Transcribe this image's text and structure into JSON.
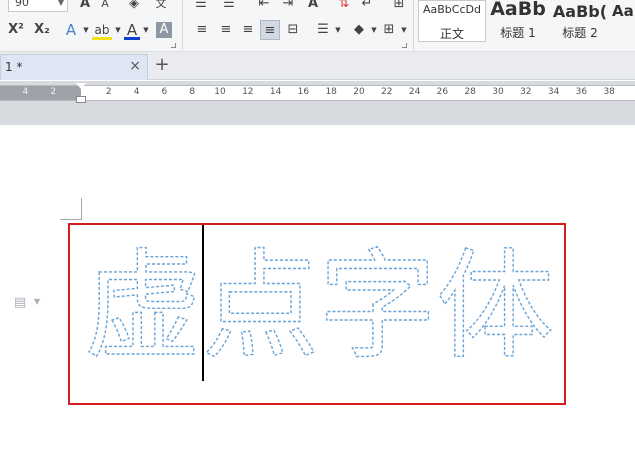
{
  "ribbon": {
    "font_size": "90",
    "grow_font": "A",
    "shrink_font": "A",
    "superscript": "X²",
    "subscript": "X₂",
    "text_effect": "A",
    "highlight": "ab",
    "font_color": "A",
    "char_shading": "A",
    "phonetic": "文",
    "styles": [
      {
        "preview": "AaBbCcDd",
        "name": "正文"
      },
      {
        "preview": "AaBb",
        "name": "标题 1"
      },
      {
        "preview": "AaBb(",
        "name": "标题 2"
      },
      {
        "preview": "Aa",
        "name": ""
      }
    ],
    "colors": {
      "font_color_bar": "#0b3fd6",
      "highlight_bar": "#f3e019",
      "shading_bar": "#6f7a88"
    }
  },
  "tab": {
    "title": "1 *",
    "close": "×",
    "add": "+"
  },
  "ruler": {
    "left_numbers": [
      "4",
      "2"
    ],
    "right_numbers": [
      "2",
      "4",
      "6",
      "8",
      "10",
      "12",
      "14",
      "16",
      "18",
      "20",
      "22",
      "24",
      "26",
      "28",
      "30",
      "32",
      "34",
      "36",
      "38"
    ]
  },
  "document": {
    "text": "虚点字体",
    "text_stroke_color": "#6aa4d6",
    "box_border_color": "#d41d1d"
  }
}
